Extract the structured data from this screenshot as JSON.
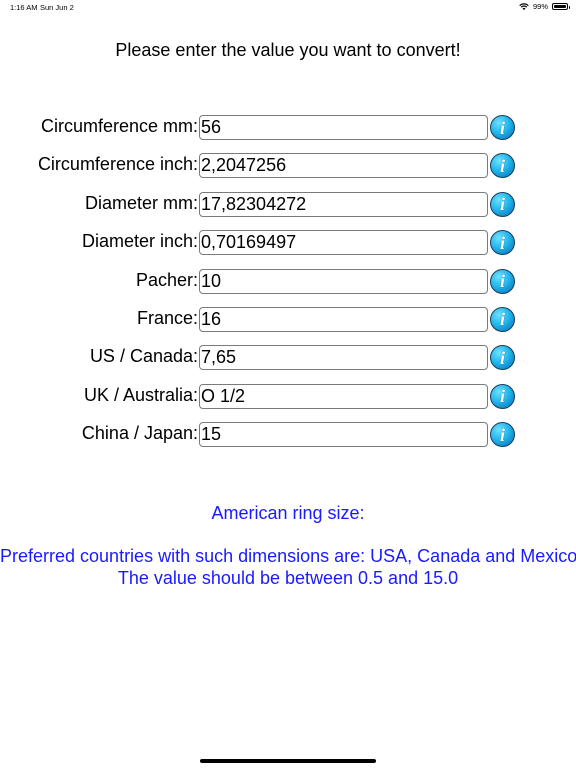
{
  "status_bar": {
    "time": "1:16 AM",
    "date": "Sun Jun 2",
    "battery_percent": "99%",
    "battery_level": 0.99,
    "wifi_icon": "wifi-icon",
    "battery_icon": "battery-icon"
  },
  "page": {
    "title": "Please enter the value you want to convert!"
  },
  "rows": [
    {
      "label": "Circumference mm:",
      "value": "56"
    },
    {
      "label": "Circumference inch:",
      "value": "2,2047256"
    },
    {
      "label": "Diameter mm:",
      "value": "17,82304272"
    },
    {
      "label": "Diameter inch:",
      "value": "0,70169497"
    },
    {
      "label": "Pacher:",
      "value": "10"
    },
    {
      "label": "France:",
      "value": "16"
    },
    {
      "label": "US / Canada:",
      "value": "7,65"
    },
    {
      "label": "UK / Australia:",
      "value": "O 1/2"
    },
    {
      "label": "China / Japan:",
      "value": "15"
    }
  ],
  "info_icon": "info-icon",
  "info_glyph": "i",
  "info": {
    "heading": "American ring size:",
    "line1": "Preferred countries with such dimensions are: USA, Canada and Mexico.",
    "line2": "The value should be between 0.5 and 15.0"
  },
  "colors": {
    "info_text": "#1a1aff",
    "info_button": "#22b7ec"
  }
}
